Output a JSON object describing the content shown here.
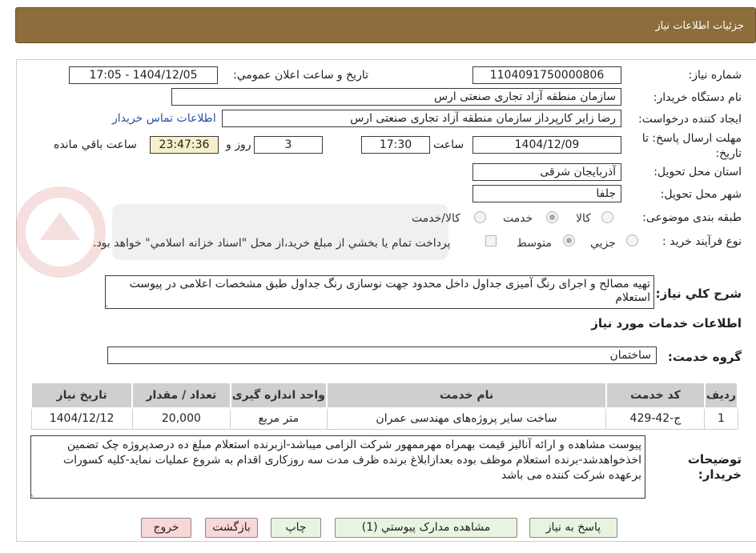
{
  "header": {
    "title": "جزئيات اطلاعات نياز"
  },
  "form": {
    "need_number_label": "شماره نياز:",
    "need_number": "1104091750000806",
    "announce_label": "تاريخ و ساعت اعلان عمومي:",
    "announce_value": "1404/12/05 - 17:05",
    "buyer_org_label": "نام دستگاه خريدار:",
    "buyer_org": "سازمان منطقه آزاد تجاری صنعتی ارس",
    "requester_label": "ايجاد کننده درخواست:",
    "requester": "رضا زایر کارپرداز سازمان منطقه آزاد تجاری صنعتی ارس",
    "contact_link": "اطلاعات تماس خريدار",
    "deadline_label": "مهلت ارسال پاسخ: تا تاريخ:",
    "deadline_date": "1404/12/09",
    "time_label": "ساعت",
    "deadline_time": "17:30",
    "days_value": "3",
    "days_label": "روز و",
    "remaining_value": "23:47:36",
    "remaining_label": "ساعت باقي مانده",
    "province_label": "استان محل تحويل:",
    "province": "آذربايجان شرقی",
    "city_label": "شهر محل تحويل:",
    "city": "جلفا",
    "category_label": "طبقه بندی موضوعی:",
    "category_options": [
      "کالا",
      "خدمت",
      "کالا/خدمت"
    ],
    "process_label": "نوع فرآيند خريد :",
    "process_options": [
      "جزيي",
      "متوسط"
    ],
    "payment_note": "پرداخت تمام يا بخشي از مبلغ خريد،از محل \"اسناد خزانه اسلامي\" خواهد بود.",
    "description_label": "شرح کلي نياز:",
    "description": "تهیه مصالح و اجرای رنگ آمیزی جداول داخل محدود جهت نوسازی رنگ جداول طبق مشخصات اعلامی در پیوست استعلام",
    "services_title": "اطلاعات خدمات مورد نياز",
    "service_group_label": "گروه خدمت:",
    "service_group": "ساختمان"
  },
  "table": {
    "headers": [
      "رديف",
      "کد خدمت",
      "نام خدمت",
      "واحد اندازه گيری",
      "تعداد / مقدار",
      "تاريخ نياز"
    ],
    "rows": [
      [
        "1",
        "ج-42-429",
        "ساخت سایر پروژه‌های مهندسی عمران",
        "متر مربع",
        "20,000",
        "1404/12/12"
      ]
    ]
  },
  "buyer_notes": {
    "label": "توضيحات خريدار:",
    "text": "پیوست مشاهده و ارائه آنالیز قیمت بهمراه مهرممهور شرکت الزامی میباشد-ازبرنده استعلام مبلغ ده درصدپروژه چک تضمین اخذخواهدشد-برنده استعلام موظف بوده بعدازابلاغ برنده ظرف مدت سه روزکاری اقدام به شروع عملیات نماید-کلیه کسورات برعهده شرکت کننده می باشد"
  },
  "buttons": {
    "reply": "پاسخ به نياز",
    "attachments": "مشاهده مدارک پيوستي (1)",
    "print": "چاپ",
    "back": "بازگشت",
    "exit": "خروج"
  },
  "colors": {
    "header_bg": "#8d6d3b",
    "button_green": "#e8f4e0",
    "button_pink": "#f8d7d7",
    "link": "#2b4fa8"
  }
}
